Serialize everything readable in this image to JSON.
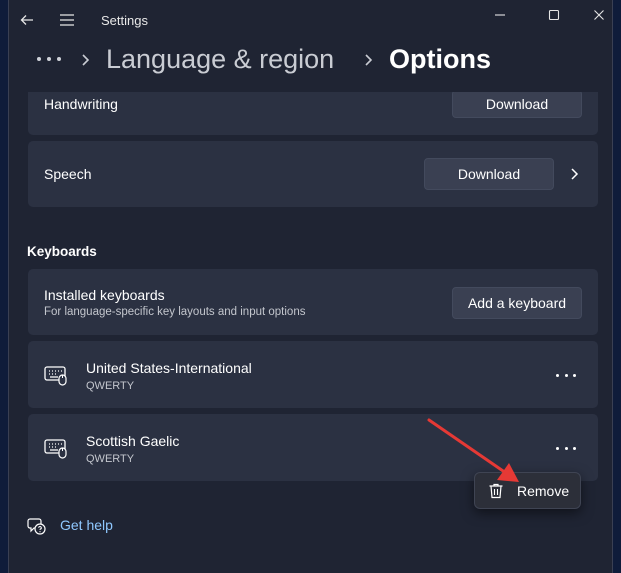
{
  "window": {
    "title": "Settings"
  },
  "breadcrumb": {
    "parent": "Language & region",
    "current": "Options"
  },
  "handwriting": {
    "label": "Handwriting",
    "button": "Download"
  },
  "speech": {
    "label": "Speech",
    "button": "Download"
  },
  "keyboards": {
    "section_title": "Keyboards",
    "installed_label": "Installed keyboards",
    "installed_sub": "For language-specific key layouts and input options",
    "add_button": "Add a keyboard",
    "items": [
      {
        "name": "United States-International",
        "layout": "QWERTY"
      },
      {
        "name": "Scottish Gaelic",
        "layout": "QWERTY"
      }
    ]
  },
  "context_menu": {
    "remove": "Remove"
  },
  "footer": {
    "help": "Get help"
  },
  "colors": {
    "accent_arrow": "#e53935",
    "link": "#8fc8ff",
    "card": "#2b3142",
    "background": "#1f2433"
  }
}
